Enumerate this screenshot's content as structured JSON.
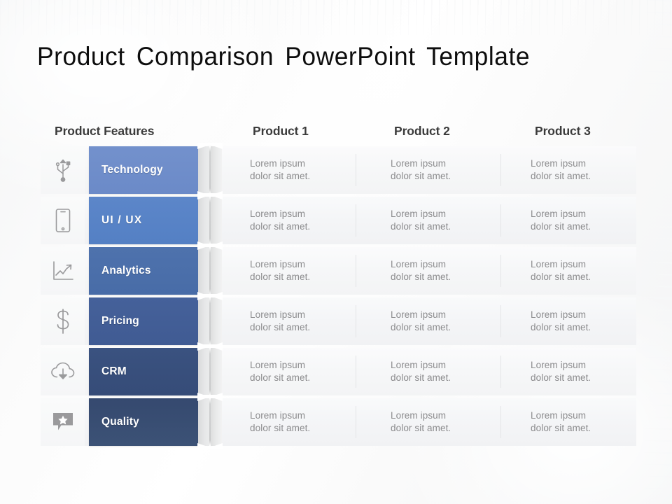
{
  "slide": {
    "title": "Product Comparison PowerPoint Template",
    "background_color": "#fafbfb"
  },
  "headers": {
    "features": "Product Features",
    "product_1": "Product 1",
    "product_2": "Product 2",
    "product_3": "Product 3"
  },
  "palette": {
    "bar_1": "#7391cc",
    "bar_2": "#5c86c9",
    "bar_3": "#4e72ad",
    "bar_4": "#45619a",
    "bar_5": "#3a5280",
    "bar_6": "#35496f",
    "row_band": "#f5f6f7",
    "body_text": "#8b8b8d",
    "header_text": "#3b3b3b",
    "title_text": "#0d0d0d",
    "ribbon_grey": "#e6e7e8",
    "icon_grey": "#9a9a9c"
  },
  "rows": [
    {
      "icon": "usb-icon",
      "label": "Technology",
      "bar_color": "#7391cc",
      "bar_color_dark": "#6b8ac8",
      "product_1": "Lorem ipsum\ndolor sit amet.",
      "product_2": "Lorem ipsum\ndolor sit amet.",
      "product_3": "Lorem ipsum\ndolor sit amet."
    },
    {
      "icon": "smartphone-icon",
      "label": "UI / UX",
      "bar_color": "#5c86c9",
      "bar_color_dark": "#5480c4",
      "product_1": "Lorem ipsum\ndolor sit amet.",
      "product_2": "Lorem ipsum\ndolor sit amet.",
      "product_3": "Lorem ipsum\ndolor sit amet."
    },
    {
      "icon": "line-chart-icon",
      "label": "Analytics",
      "bar_color": "#4e72ad",
      "bar_color_dark": "#486ca7",
      "product_1": "Lorem ipsum\ndolor sit amet.",
      "product_2": "Lorem ipsum\ndolor sit amet.",
      "product_3": "Lorem ipsum\ndolor sit amet."
    },
    {
      "icon": "dollar-icon",
      "label": "Pricing",
      "bar_color": "#45619a",
      "bar_color_dark": "#405b93",
      "product_1": "Lorem ipsum\ndolor sit amet.",
      "product_2": "Lorem ipsum\ndolor sit amet.",
      "product_3": "Lorem ipsum\ndolor sit amet."
    },
    {
      "icon": "cloud-download-icon",
      "label": "CRM",
      "bar_color": "#3a5280",
      "bar_color_dark": "#364c78",
      "product_1": "Lorem ipsum\ndolor sit amet.",
      "product_2": "Lorem ipsum\ndolor sit amet.",
      "product_3": "Lorem ipsum\ndolor sit amet."
    },
    {
      "icon": "star-comment-icon",
      "label": "Quality",
      "bar_color": "#35496f",
      "bar_color_dark": "#3c5276",
      "product_1": "Lorem ipsum\ndolor sit amet.",
      "product_2": "Lorem ipsum\ndolor sit amet.",
      "product_3": "Lorem ipsum\ndolor sit amet."
    }
  ]
}
